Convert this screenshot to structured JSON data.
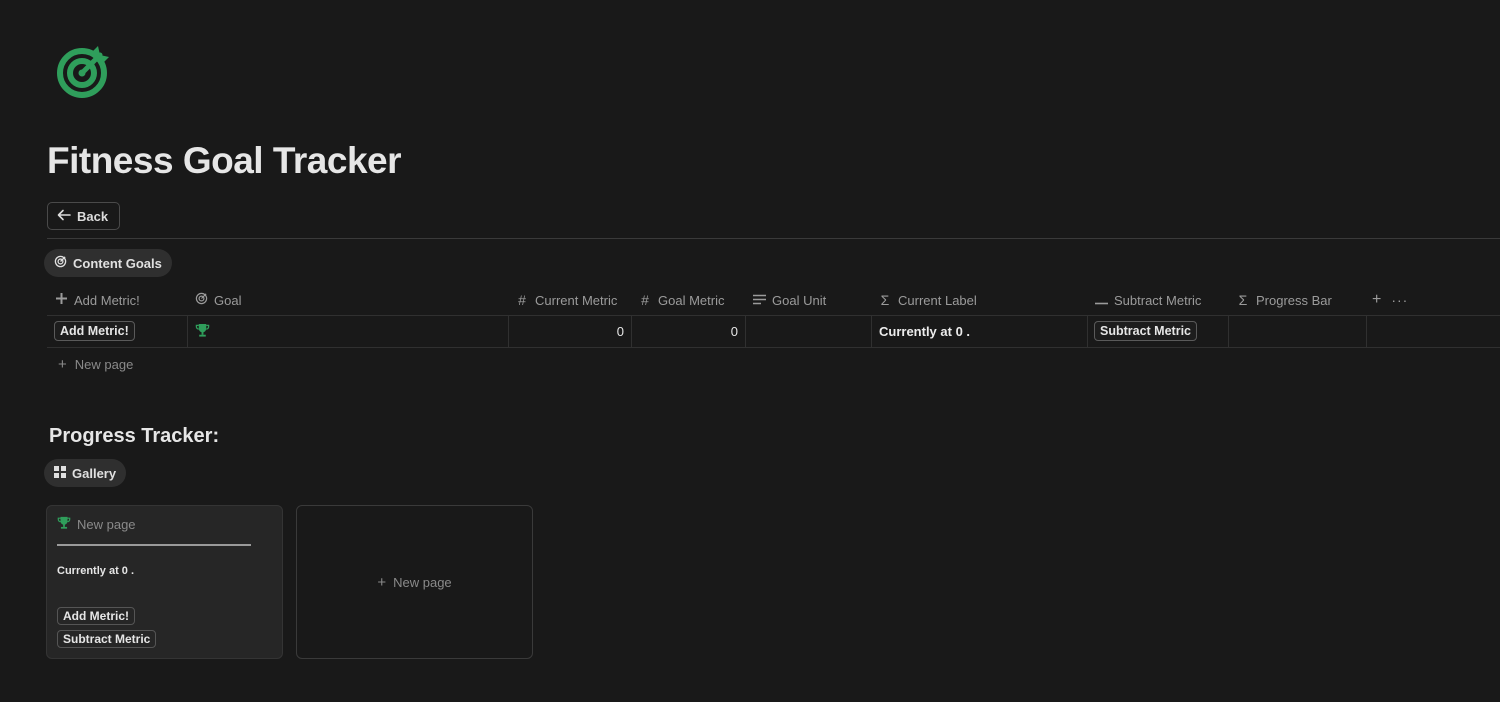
{
  "page": {
    "title": "Fitness Goal Tracker",
    "icon": "target-icon",
    "accent_color": "#2f9e5b",
    "back_label": "Back"
  },
  "database": {
    "view_label": "Content Goals",
    "columns": [
      {
        "icon": "plus-icon",
        "label": "Add Metric!"
      },
      {
        "icon": "target-icon",
        "label": "Goal"
      },
      {
        "icon": "hash-icon",
        "label": "Current Metric"
      },
      {
        "icon": "hash-icon",
        "label": "Goal Metric"
      },
      {
        "icon": "text-lines-icon",
        "label": "Goal Unit"
      },
      {
        "icon": "sigma-icon",
        "label": "Current Label"
      },
      {
        "icon": "minus-icon",
        "label": "Subtract Metric"
      },
      {
        "icon": "sigma-icon",
        "label": "Progress Bar"
      }
    ],
    "row": {
      "add_metric": "Add Metric!",
      "goal_icon": "trophy-icon",
      "current_metric": "0",
      "goal_metric": "0",
      "goal_unit": "",
      "current_label": "Currently at 0 .",
      "subtract_metric": "Subtract Metric",
      "progress_bar": ""
    },
    "new_page_label": "New page"
  },
  "progress": {
    "heading": "Progress Tracker:",
    "view_label": "Gallery",
    "card": {
      "title": "New page",
      "label": "Currently at 0 .",
      "add_button": "Add Metric!",
      "subtract_button": "Subtract Metric"
    },
    "new_card_label": "New page"
  }
}
